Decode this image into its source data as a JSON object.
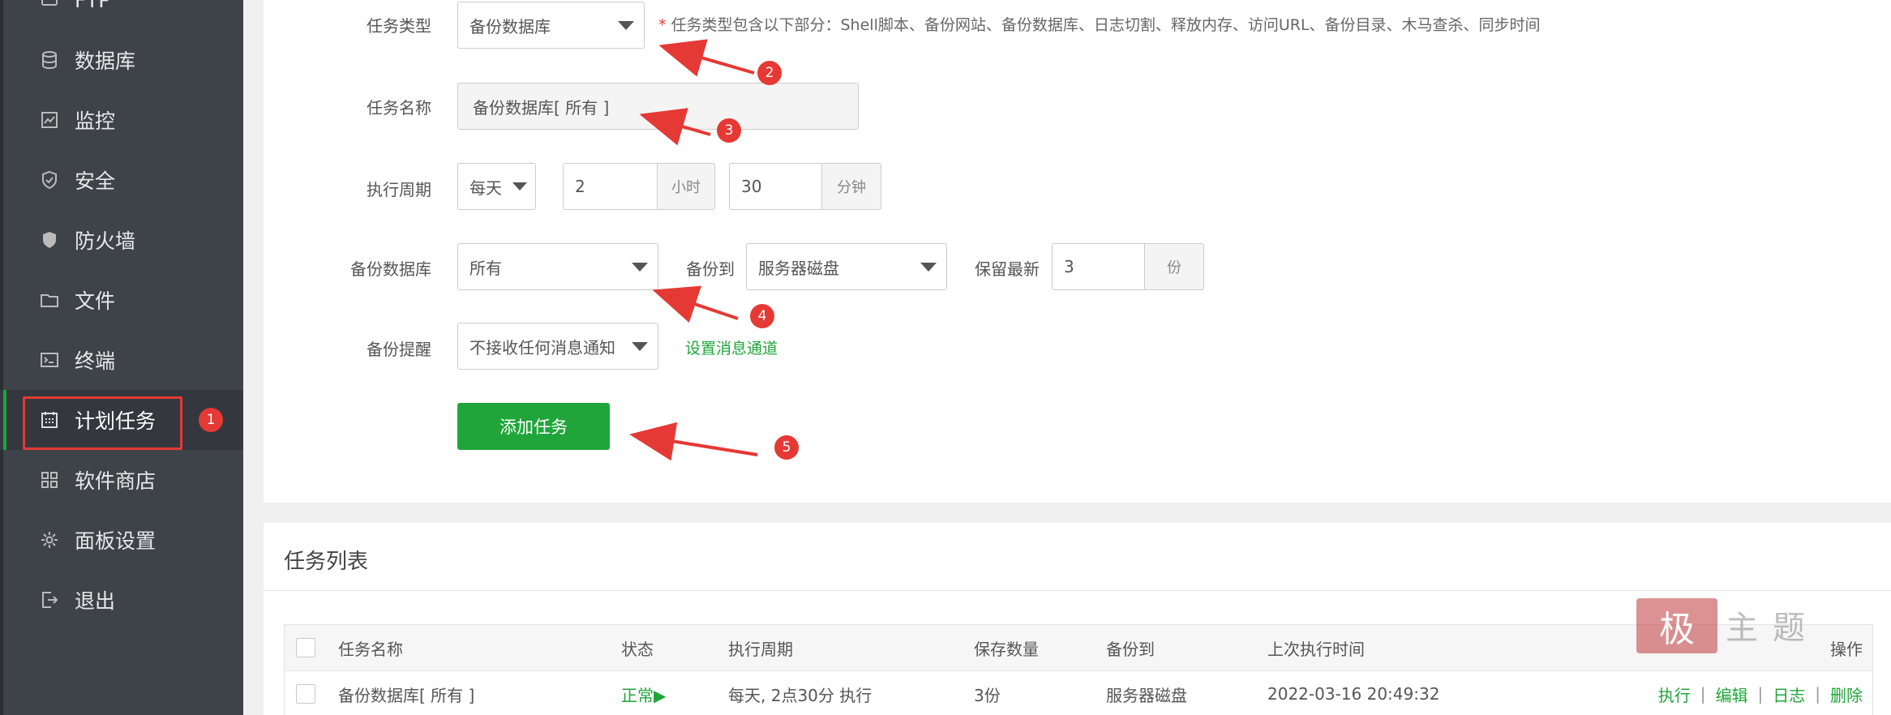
{
  "sidebar": {
    "items": [
      {
        "label": "FTP",
        "icon": "ftp-icon"
      },
      {
        "label": "数据库",
        "icon": "database-icon"
      },
      {
        "label": "监控",
        "icon": "monitor-icon"
      },
      {
        "label": "安全",
        "icon": "shield-icon"
      },
      {
        "label": "防火墙",
        "icon": "firewall-icon"
      },
      {
        "label": "文件",
        "icon": "folder-icon"
      },
      {
        "label": "终端",
        "icon": "terminal-icon"
      },
      {
        "label": "计划任务",
        "icon": "calendar-icon",
        "active": true
      },
      {
        "label": "软件商店",
        "icon": "apps-grid-icon"
      },
      {
        "label": "面板设置",
        "icon": "gear-icon"
      },
      {
        "label": "退出",
        "icon": "logout-icon"
      }
    ]
  },
  "annotations": [
    "1",
    "2",
    "3",
    "4",
    "5"
  ],
  "form": {
    "task_type": {
      "label": "任务类型",
      "value": "备份数据库"
    },
    "hint_star": "*",
    "hint": "任务类型包含以下部分：Shell脚本、备份网站、备份数据库、日志切割、释放内存、访问URL、备份目录、木马查杀、同步时间",
    "task_name": {
      "label": "任务名称",
      "value": "备份数据库[ 所有 ]"
    },
    "period": {
      "label": "执行周期",
      "type": "每天",
      "hour": "2",
      "hour_unit": "小时",
      "minute": "30",
      "minute_unit": "分钟"
    },
    "backup_db": {
      "label": "备份数据库",
      "value": "所有"
    },
    "backup_to": {
      "label": "备份到",
      "value": "服务器磁盘"
    },
    "keep": {
      "label": "保留最新",
      "value": "3",
      "unit": "份"
    },
    "notify": {
      "label": "备份提醒",
      "value": "不接收任何消息通知",
      "link": "设置消息通道"
    },
    "submit": "添加任务"
  },
  "task_list": {
    "title": "任务列表",
    "columns": [
      "任务名称",
      "状态",
      "执行周期",
      "保存数量",
      "备份到",
      "上次执行时间",
      "操作"
    ],
    "rows": [
      {
        "name": "备份数据库[ 所有 ]",
        "status": "正常▶",
        "period": "每天, 2点30分 执行",
        "keep": "3份",
        "target": "服务器磁盘",
        "last_run": "2022-03-16 20:49:32",
        "actions": [
          "执行",
          "编辑",
          "日志",
          "删除"
        ]
      }
    ]
  },
  "watermark": {
    "seal": "极",
    "text": "主题"
  },
  "colors": {
    "sidebar_bg": "#3e4249",
    "accent": "#20a53a",
    "annotation": "#e53935"
  }
}
